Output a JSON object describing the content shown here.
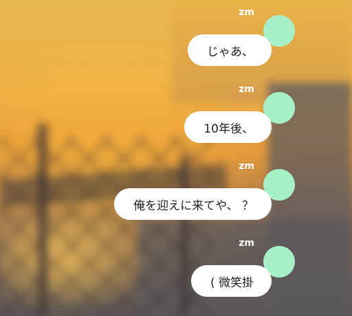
{
  "colors": {
    "avatar": "#a8f0c8",
    "bubble_background": "#ffffff",
    "username_text": "#ffffff",
    "message_text": "#222222"
  },
  "messages": [
    {
      "username": "zm",
      "text": "じゃあ、"
    },
    {
      "username": "zm",
      "text": "10年後、"
    },
    {
      "username": "zm",
      "text": "俺を迎えに来てや、 ？"
    },
    {
      "username": "zm",
      "text": "( 微笑掛"
    }
  ]
}
